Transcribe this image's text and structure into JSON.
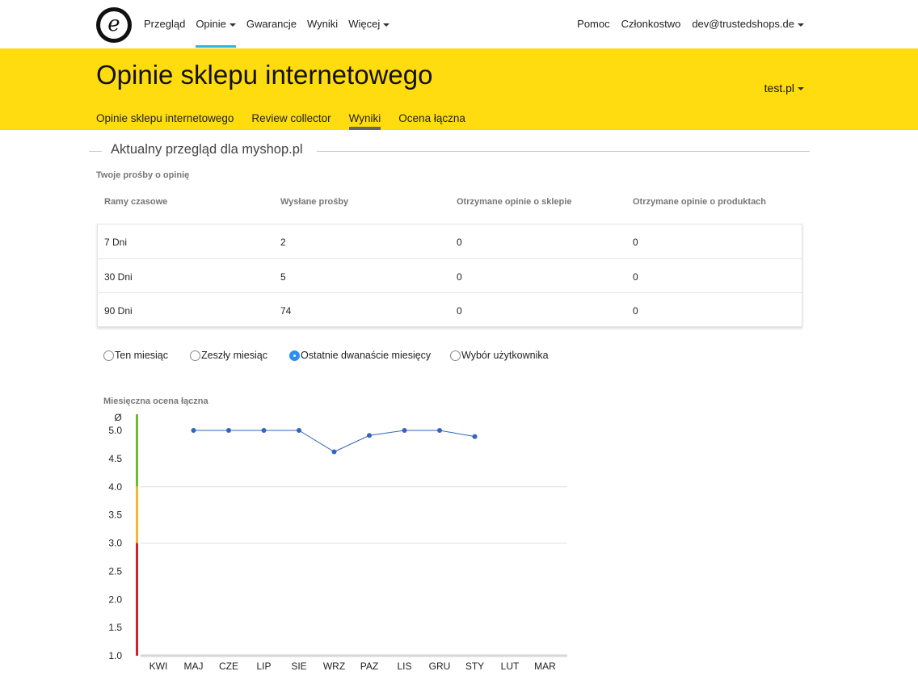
{
  "nav": {
    "logo_letter": "e",
    "left_items": [
      {
        "label": "Przegląd",
        "dropdown": false,
        "active": false
      },
      {
        "label": "Opinie",
        "dropdown": true,
        "active": true
      },
      {
        "label": "Gwarancje",
        "dropdown": false,
        "active": false
      },
      {
        "label": "Wyniki",
        "dropdown": false,
        "active": false
      },
      {
        "label": "Więcej",
        "dropdown": true,
        "active": false
      }
    ],
    "right_items": [
      {
        "label": "Pomoc",
        "dropdown": false
      },
      {
        "label": "Członkostwo",
        "dropdown": false
      },
      {
        "label": "dev@trustedshops.de",
        "dropdown": true
      }
    ],
    "active_color": "#29b8d8"
  },
  "header": {
    "title": "Opinie sklepu internetowego",
    "shop_selector": "test.pl",
    "background": "#ffdc0f",
    "tabs": [
      {
        "label": "Opinie sklepu internetowego",
        "active": false
      },
      {
        "label": "Review collector",
        "active": false
      },
      {
        "label": "Wyniki",
        "active": true
      },
      {
        "label": "Ocena łączna",
        "active": false
      }
    ]
  },
  "overview": {
    "title": "Aktualny przegląd dla myshop.pl",
    "requests_label": "Twoje prośby o opinię",
    "columns": [
      "Ramy czasowe",
      "Wysłane prośby",
      "Otrzymane opinie o sklepie",
      "Otrzymane opinie o produktach"
    ],
    "rows": [
      [
        "7 Dni",
        "2",
        "0",
        "0"
      ],
      [
        "30 Dni",
        "5",
        "0",
        "0"
      ],
      [
        "90 Dni",
        "74",
        "0",
        "0"
      ]
    ]
  },
  "period_options": [
    {
      "label": "Ten miesiąc",
      "checked": false
    },
    {
      "label": "Zeszły miesiąc",
      "checked": false
    },
    {
      "label": "Ostatnie dwanaście miesięcy",
      "checked": true
    },
    {
      "label": "Wybór użytkownika",
      "checked": false
    }
  ],
  "chart_data": {
    "type": "line",
    "title": "Miesięczna ocena łączna",
    "ylabel": "Ø",
    "ylim": [
      1.0,
      5.0
    ],
    "yticks": [
      "5.0",
      "4.5",
      "4.0",
      "3.5",
      "3.0",
      "2.5",
      "2.0",
      "1.5",
      "1.0"
    ],
    "categories": [
      "KWI",
      "MAJ",
      "CZE",
      "LIP",
      "SIE",
      "WRZ",
      "PAZ",
      "LIS",
      "GRU",
      "STY",
      "LUT",
      "MAR"
    ],
    "series": [
      {
        "values": [
          null,
          5.0,
          5.0,
          5.0,
          5.0,
          4.62,
          4.91,
          5.0,
          5.0,
          4.89,
          null,
          null
        ],
        "color": "#3366bb"
      }
    ],
    "gridlines": [
      4.0,
      3.0
    ],
    "rating_bands": [
      {
        "from": 4.0,
        "to": 5.0,
        "color": "#6cbd2c"
      },
      {
        "from": 3.0,
        "to": 4.0,
        "color": "#f5b731"
      },
      {
        "from": 1.0,
        "to": 3.0,
        "color": "#cc2233"
      }
    ]
  }
}
